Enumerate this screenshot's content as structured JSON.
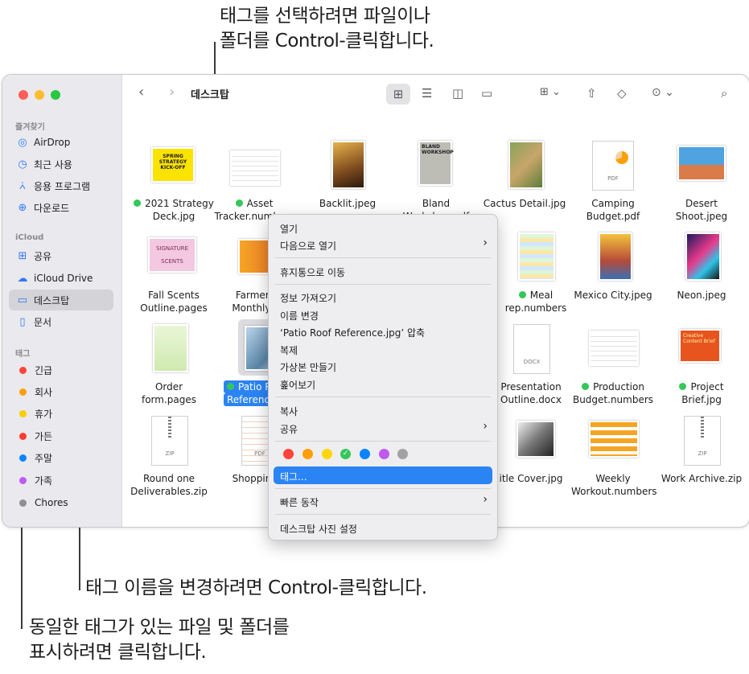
{
  "callouts": {
    "top_line1": "태그를 선택하려면 파일이나",
    "top_line2": "폴더를 Control-클릭합니다.",
    "middle": "태그 이름을 변경하려면 Control-클릭합니다.",
    "bottom_line1": "동일한 태그가 있는 파일 및 폴더를",
    "bottom_line2": "표시하려면 클릭합니다."
  },
  "window": {
    "title": "데스크탑"
  },
  "colors": {
    "accent": "#2b84f4",
    "green": "#34c759"
  },
  "sidebar": {
    "favorites_header": "즐겨찾기",
    "favorites": [
      {
        "label": "AirDrop",
        "icon": "airdrop-icon"
      },
      {
        "label": "최근 사용",
        "icon": "clock-icon"
      },
      {
        "label": "응용 프로그램",
        "icon": "apps-icon"
      },
      {
        "label": "다운로드",
        "icon": "download-icon"
      }
    ],
    "icloud_header": "iCloud",
    "icloud": [
      {
        "label": "공유",
        "icon": "shared-folder-icon"
      },
      {
        "label": "iCloud Drive",
        "icon": "cloud-icon"
      },
      {
        "label": "데스크탑",
        "icon": "desktop-icon"
      },
      {
        "label": "문서",
        "icon": "document-icon"
      }
    ],
    "tags_header": "태그",
    "tags": [
      {
        "label": "긴급",
        "color": "#ff453a"
      },
      {
        "label": "회사",
        "color": "#ff9f0a"
      },
      {
        "label": "휴가",
        "color": "#ffcc00"
      },
      {
        "label": "가든",
        "color": "#ff3b30"
      },
      {
        "label": "주말",
        "color": "#0a84ff"
      },
      {
        "label": "가족",
        "color": "#bf5af2"
      },
      {
        "label": "Chores",
        "color": "#8e8e93"
      }
    ]
  },
  "files": [
    {
      "l1": "2021 Strategy",
      "l2": "Deck.jpg"
    },
    {
      "l1": "Asset",
      "l2": "Tracker.numbers"
    },
    {
      "l1": "Backlit.jpeg",
      "l2": ""
    },
    {
      "l1": "Bland",
      "l2": "Workshop.pdf"
    },
    {
      "l1": "Cactus Detail.jpg",
      "l2": ""
    },
    {
      "l1": "Camping",
      "l2": "Budget.pdf"
    },
    {
      "l1": "Desert Shoot.jpeg",
      "l2": ""
    },
    {
      "l1": "Fall Scents",
      "l2": "Outline.pages"
    },
    {
      "l1": "Farmers M",
      "l2": "Monthly...ck"
    },
    {
      "l1": "Meal",
      "l2": "rep.numbers"
    },
    {
      "l1": "Mexico City.jpeg",
      "l2": ""
    },
    {
      "l1": "Neon.jpeg",
      "l2": ""
    },
    {
      "l1": "Order form.pages",
      "l2": ""
    },
    {
      "l1": "Patio R",
      "l2": "Referenc"
    },
    {
      "l1": "Presentation",
      "l2": "Outline.docx"
    },
    {
      "l1": "Production",
      "l2": "Budget.numbers"
    },
    {
      "l1": "Project",
      "l2": "Brief.jpg"
    },
    {
      "l1": "Round one",
      "l2": "Deliverables.zip"
    },
    {
      "l1": "Shopping L",
      "l2": ""
    },
    {
      "l1": "itle Cover.jpg",
      "l2": ""
    },
    {
      "l1": "Weekly",
      "l2": "Workout.numbers"
    },
    {
      "l1": "Work Archive.zip",
      "l2": ""
    }
  ],
  "thumb_text": {
    "strategy": "SPRING STRATEGY KICK-OFF",
    "bland": "BLAND WORKSHOP",
    "signature": "SIGNATURE SCENTS",
    "project": "Creative Content Brief",
    "docx": "DOCX",
    "pdf": "PDF",
    "zip": "ZIP"
  },
  "menu": {
    "open": "열기",
    "open_with": "다음으로 열기",
    "move_trash": "휴지통으로 이동",
    "get_info": "정보 가져오기",
    "rename": "이름 변경",
    "compress": "‘Patio Roof Reference.jpg’ 압축",
    "duplicate": "복제",
    "make_alias": "가상본 만들기",
    "quick_look": "훑어보기",
    "copy": "복사",
    "share": "공유",
    "tags": "태그...",
    "quick_actions": "빠른 동작",
    "set_desktop": "데스크탑 사진 설정",
    "tag_colors": [
      "#ff453a",
      "#ff9f0a",
      "#ffd60a",
      "#34c759",
      "#0a84ff",
      "#bf5af2",
      "#a1a1a6"
    ]
  }
}
